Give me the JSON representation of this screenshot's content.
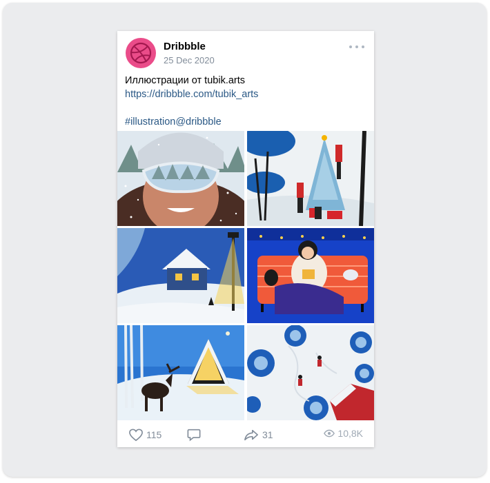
{
  "post": {
    "author": "Dribbble",
    "date": "25 Dec 2020",
    "text": "Иллюстрации от tubik.arts",
    "link": "https://dribbble.com/tubik_arts",
    "hashtag": "#illustration@dribbble"
  },
  "photos": [
    {
      "name": "photo-skier-goggles"
    },
    {
      "name": "photo-christmas-tree"
    },
    {
      "name": "photo-snowy-house"
    },
    {
      "name": "photo-girl-on-sofa"
    },
    {
      "name": "photo-moose-cabin"
    },
    {
      "name": "photo-snow-angels"
    }
  ],
  "actions": {
    "likes": "115",
    "shares": "31",
    "views": "10,8K"
  },
  "colors": {
    "brand": "#ea4c89",
    "link": "#2a5885",
    "muted": "#818c99"
  }
}
